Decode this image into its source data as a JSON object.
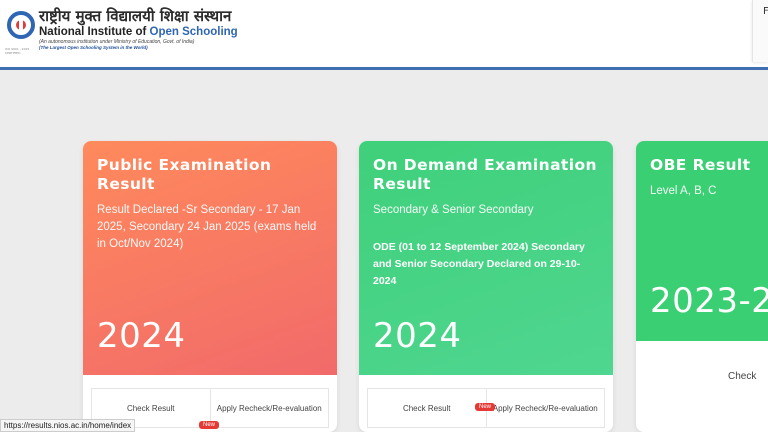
{
  "header": {
    "hindi_title": "राष्ट्रीय मुक्त विद्यालयी शिक्षा संस्थान",
    "english_prefix": "National Institute of ",
    "english_highlight": "Open Schooling",
    "subtitle": "(An autonomous institution under Ministry of Education, Govt. of India)",
    "tagline": "(The Largest Open Schooling System in the World)",
    "iso": "ISO 9001 : 2015 CERTIFIED",
    "right_letter": "F"
  },
  "cards": [
    {
      "title": "Public Examination Result",
      "description": "Result Declared -Sr Secondary - 17 Jan 2025, Secondary 24 Jan 2025 (exams held in Oct/Nov 2024)",
      "year": "2024",
      "check": "Check Result",
      "recheck": "Apply Recheck/Re-evaluation",
      "badge": "New"
    },
    {
      "title": "On Demand Examination Result",
      "description": "Secondary & Senior Secondary",
      "note": "ODE (01 to 12 September 2024) Secondary and Senior Secondary Declared on 29-10-2024",
      "year": "2024",
      "check": "Check Result",
      "recheck": "Apply Recheck/Re-evaluation",
      "badge": "New"
    },
    {
      "title": "OBE Result",
      "description": "Level A, B, C",
      "year": "2023-2",
      "check": "Check"
    }
  ],
  "status_url": "https://results.nios.ac.in/home/index",
  "colors": {
    "header_border": "#3f6fb0",
    "card1": "#f27366",
    "card2": "#44d283",
    "card3": "#39cf72",
    "badge": "#e53935"
  }
}
